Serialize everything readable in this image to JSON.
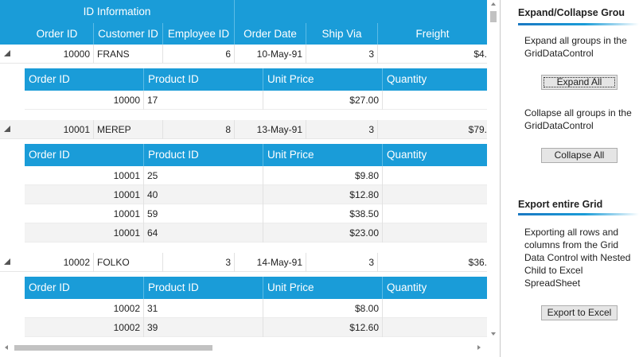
{
  "grid": {
    "band_header": "ID Information",
    "columns": [
      "Order ID",
      "Customer ID",
      "Employee ID",
      "Order Date",
      "Ship Via",
      "Freight"
    ],
    "groups": [
      {
        "order_id": "10000",
        "customer_id": "FRANS",
        "employee_id": "6",
        "order_date": "10-May-91",
        "ship_via": "3",
        "freight": "$4.",
        "child_columns": [
          "Order ID",
          "Product ID",
          "Unit Price",
          "Quantity"
        ],
        "child_rows": [
          {
            "order_id": "10000",
            "product_id": "17",
            "unit_price": "$27.00"
          }
        ]
      },
      {
        "order_id": "10001",
        "customer_id": "MEREP",
        "employee_id": "8",
        "order_date": "13-May-91",
        "ship_via": "3",
        "freight": "$79.",
        "child_columns": [
          "Order ID",
          "Product ID",
          "Unit Price",
          "Quantity"
        ],
        "child_rows": [
          {
            "order_id": "10001",
            "product_id": "25",
            "unit_price": "$9.80"
          },
          {
            "order_id": "10001",
            "product_id": "40",
            "unit_price": "$12.80"
          },
          {
            "order_id": "10001",
            "product_id": "59",
            "unit_price": "$38.50"
          },
          {
            "order_id": "10001",
            "product_id": "64",
            "unit_price": "$23.00"
          }
        ]
      },
      {
        "order_id": "10002",
        "customer_id": "FOLKO",
        "employee_id": "3",
        "order_date": "14-May-91",
        "ship_via": "3",
        "freight": "$36.",
        "child_columns": [
          "Order ID",
          "Product ID",
          "Unit Price",
          "Quantity"
        ],
        "child_rows": [
          {
            "order_id": "10002",
            "product_id": "31",
            "unit_price": "$8.00"
          },
          {
            "order_id": "10002",
            "product_id": "39",
            "unit_price": "$12.60"
          }
        ]
      }
    ]
  },
  "panel": {
    "expand_section": {
      "title": "Expand/Collapse Grou",
      "expand_desc": "Expand all groups in the GridDataControl",
      "expand_button": "Expand All",
      "collapse_desc": "Collapse all groups in the GridDataControl",
      "collapse_button": "Collapse All"
    },
    "export_section": {
      "title": "Export entire Grid",
      "desc": "Exporting all rows and columns from the Grid Data Control with Nested Child to Excel SpreadSheet",
      "button": "Export to Excel"
    }
  },
  "colors": {
    "header_blue": "#1a9cd8",
    "row_alt": "#f3f3f3",
    "section_underline": "#1a78c2"
  }
}
